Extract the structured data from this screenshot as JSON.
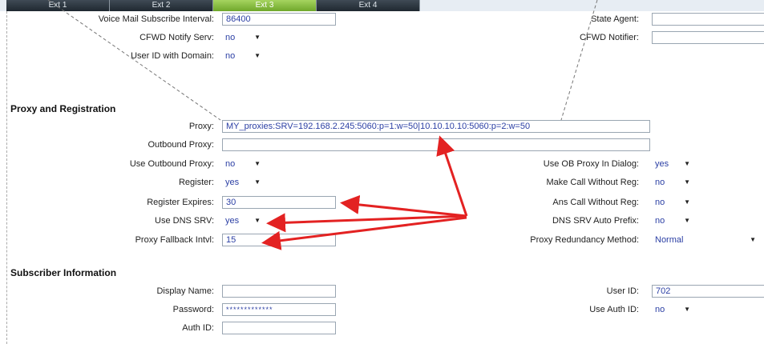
{
  "tabs": [
    "Ext 1",
    "Ext 2",
    "Ext 3",
    "Ext 4"
  ],
  "active_tab": "Ext 3",
  "general": {
    "vm_interval_label": "Voice Mail Subscribe Interval:",
    "vm_interval_value": "86400",
    "state_agent_label": "State Agent:",
    "state_agent_value": "",
    "cfwd_notify_serv_label": "CFWD Notify Serv:",
    "cfwd_notify_serv_value": "no",
    "cfwd_notifier_label": "CFWD Notifier:",
    "cfwd_notifier_value": "",
    "userid_domain_label": "User ID with Domain:",
    "userid_domain_value": "no"
  },
  "proxy_section": {
    "title": "Proxy and Registration",
    "proxy_label": "Proxy:",
    "proxy_value": "MY_proxies:SRV=192.168.2.245:5060:p=1:w=50|10.10.10.10:5060:p=2:w=50",
    "outbound_proxy_label": "Outbound Proxy:",
    "outbound_proxy_value": "",
    "use_outbound_proxy_label": "Use Outbound Proxy:",
    "use_outbound_proxy_value": "no",
    "use_ob_proxy_dialog_label": "Use OB Proxy In Dialog:",
    "use_ob_proxy_dialog_value": "yes",
    "register_label": "Register:",
    "register_value": "yes",
    "make_call_without_reg_label": "Make Call Without Reg:",
    "make_call_without_reg_value": "no",
    "register_expires_label": "Register Expires:",
    "register_expires_value": "30",
    "ans_call_without_reg_label": "Ans Call Without Reg:",
    "ans_call_without_reg_value": "no",
    "use_dns_srv_label": "Use DNS SRV:",
    "use_dns_srv_value": "yes",
    "dns_srv_auto_prefix_label": "DNS SRV Auto Prefix:",
    "dns_srv_auto_prefix_value": "no",
    "proxy_fallback_label": "Proxy Fallback Intvl:",
    "proxy_fallback_value": "15",
    "proxy_redundancy_label": "Proxy Redundancy Method:",
    "proxy_redundancy_value": "Normal"
  },
  "subscriber_section": {
    "title": "Subscriber Information",
    "display_name_label": "Display Name:",
    "display_name_value": "",
    "user_id_label": "User ID:",
    "user_id_value": "702",
    "password_label": "Password:",
    "password_value": "*************",
    "use_auth_id_label": "Use Auth ID:",
    "use_auth_id_value": "no",
    "auth_id_label": "Auth ID:",
    "auth_id_value": ""
  },
  "colors": {
    "accent_green": "#8cc63f",
    "tab_dark": "#2a343d",
    "arrow_red": "#e32222",
    "value_blue": "#2b3fa4"
  }
}
